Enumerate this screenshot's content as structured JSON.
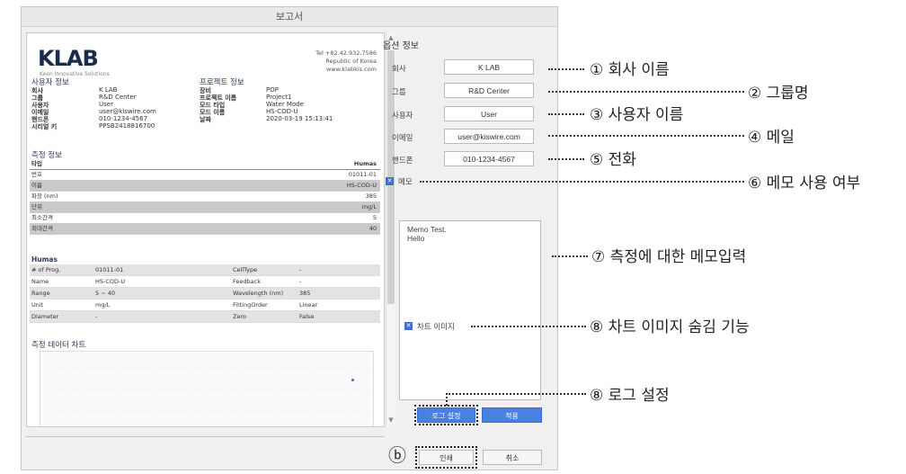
{
  "window": {
    "title": "보고서"
  },
  "preview": {
    "logo": "KLAB",
    "tagline": "Keen Innovative Solutions",
    "contact": [
      "Tel +82.42.932.7586",
      "Republic of Korea",
      "www.klabkis.com"
    ],
    "user_info": {
      "title": "사용자 정보",
      "rows": [
        {
          "label": "회사",
          "value": "K LAB"
        },
        {
          "label": "그룹",
          "value": "R&D Center"
        },
        {
          "label": "사용자",
          "value": "User"
        },
        {
          "label": "이메일",
          "value": "user@kiswire.com"
        },
        {
          "label": "핸드폰",
          "value": "010-1234-4567"
        },
        {
          "label": "시리얼 키",
          "value": "PPSB2418816700"
        }
      ]
    },
    "project_info": {
      "title": "프로젝트 정보",
      "rows": [
        {
          "label": "장비",
          "value": "POP"
        },
        {
          "label": "프로젝트 이름",
          "value": "Project1"
        },
        {
          "label": "모드 타입",
          "value": "Water Mode"
        },
        {
          "label": "모드 이름",
          "value": "HS-COD-U"
        },
        {
          "label": "날짜",
          "value": "2020-03-19 15:13:41"
        }
      ]
    },
    "measure_info": {
      "title": "측정 정보",
      "header": {
        "label": "타입",
        "value": "Humas"
      },
      "rows": [
        {
          "label": "번호",
          "value": "01011-01"
        },
        {
          "label": "이름",
          "value": "HS-COD-U"
        },
        {
          "label": "파장 (nm)",
          "value": "385"
        },
        {
          "label": "단위",
          "value": "mg/L"
        },
        {
          "label": "최소간격",
          "value": "5"
        },
        {
          "label": "최대간격",
          "value": "40"
        }
      ]
    },
    "humas": {
      "title": "Humas",
      "rows": [
        [
          "# of Prog.",
          "01011-01",
          "CellType",
          "-"
        ],
        [
          "Name",
          "HS-COD-U",
          "Feedback",
          "-"
        ],
        [
          "Range",
          "5 ~ 40",
          "Wavelength (nm)",
          "385"
        ],
        [
          "Unit",
          "mg/L",
          "FittingOrder",
          "Linear"
        ],
        [
          "Diameter",
          "-",
          "Zero",
          "False"
        ]
      ]
    },
    "chart": {
      "title": "측정 데이터 차트"
    }
  },
  "options": {
    "title": "옵션 정보",
    "fields": [
      {
        "label": "회사",
        "value": "K LAB"
      },
      {
        "label": "그룹",
        "value": "R&D Center"
      },
      {
        "label": "사용자",
        "value": "User"
      },
      {
        "label": "이메일",
        "value": "user@kiswire.com"
      },
      {
        "label": "핸드폰",
        "value": "010-1234-4567"
      }
    ],
    "memo_check": {
      "label": "메모",
      "checked": true
    },
    "memo_text": "Memo Test.\nHello",
    "chart_check": {
      "label": "차트 이미지",
      "checked": true
    },
    "log_button": "로그 설정",
    "apply_button": "적용",
    "print_button": "인쇄",
    "cancel_button": "취소"
  },
  "annotations": {
    "a1": "① 회사 이름",
    "a2": "② 그룹명",
    "a3": "③ 사용자 이름",
    "a4": "④ 메일",
    "a5": "⑤ 전화",
    "a6": "⑥ 메모 사용 여부",
    "a7": "⑦ 측정에 대한 메모입력",
    "a8": "⑧ 차트 이미지 숨김 기능",
    "a9": "⑧ 로그 설정",
    "b": "ⓑ"
  },
  "colors": {
    "accent": "#4b7fe0",
    "checkbox": "#3c6fd1"
  }
}
